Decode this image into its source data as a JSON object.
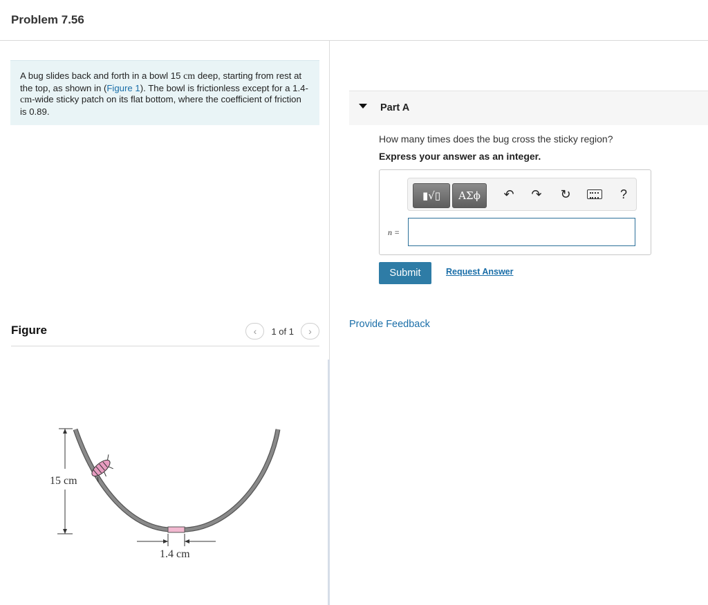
{
  "page": {
    "title": "Problem 7.56"
  },
  "problem": {
    "text_1": "A bug slides back and forth in a bowl 15 ",
    "unit_cm_1": "cm",
    "text_2": " deep, starting from rest at the top, as shown in (",
    "figure_link": "Figure 1",
    "text_3": "). The bowl is frictionless except for a 1.4-",
    "unit_cm_2": "cm",
    "text_4": "-wide sticky patch on its flat bottom, where the coefficient of friction is 0.89."
  },
  "figure": {
    "title": "Figure",
    "pager": {
      "prev_icon": "chevron-left-icon",
      "next_icon": "chevron-right-icon",
      "count": "1 of 1"
    },
    "labels": {
      "depth": "15 cm",
      "patch_width": "1.4 cm"
    },
    "colors": {
      "bowl": "#8a8a8a",
      "patch": "#f2b8d0",
      "bug": "#e79cc0"
    }
  },
  "part_a": {
    "title": "Part A",
    "question": "How many times does the bug cross the sticky region?",
    "instruction": "Express your answer as an integer.",
    "toolbar": {
      "templates_label": "▮√▯",
      "greek_label": "ΑΣϕ",
      "undo_icon": "↶",
      "redo_icon": "↷",
      "reset_icon": "↻",
      "keyboard_icon": "keyboard-icon",
      "help_label": "?"
    },
    "variable_label": "n =",
    "answer_value": "",
    "submit_label": "Submit",
    "request_label": "Request Answer"
  },
  "feedback_label": "Provide Feedback",
  "colors": {
    "accent": "#2e7ca6",
    "link": "#1a6ea8",
    "problem_bg": "#e9f4f6"
  }
}
